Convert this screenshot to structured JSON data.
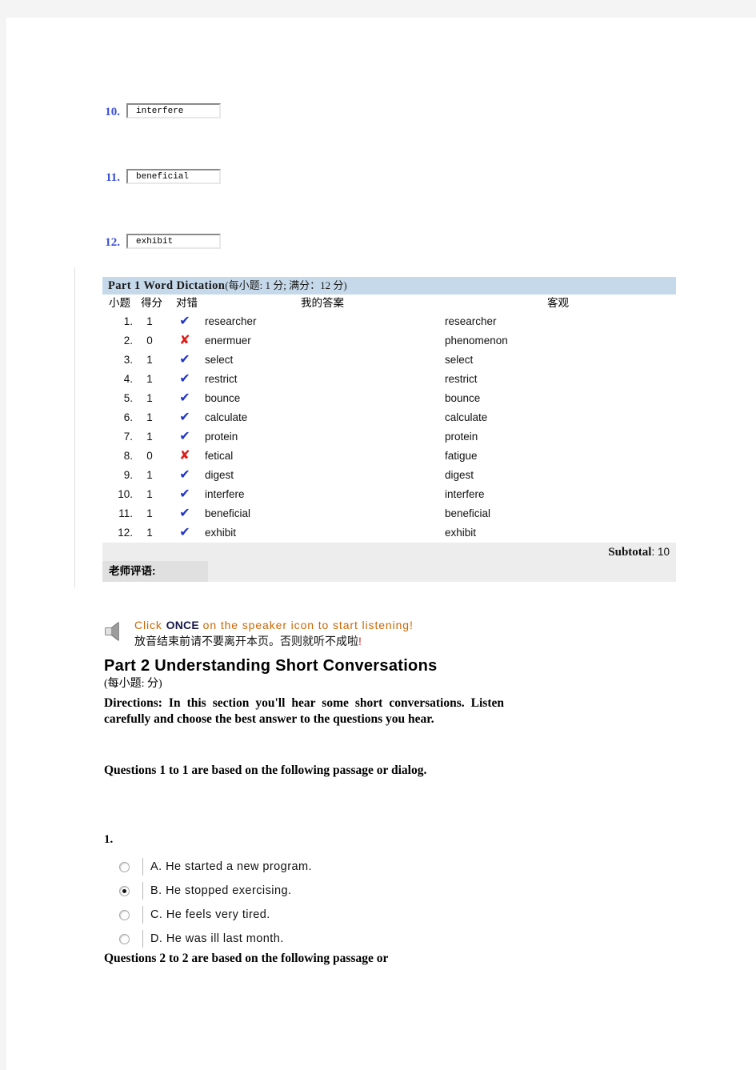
{
  "word_entries": [
    {
      "number": "10.",
      "value": "interfere"
    },
    {
      "number": "11.",
      "value": "beneficial"
    },
    {
      "number": "12.",
      "value": "exhibit"
    }
  ],
  "score_table": {
    "title": "Part 1 Word Dictation",
    "points_note": "(每小题: 1 分; 满分：12 分)",
    "columns": {
      "number": "小题",
      "score": "得分",
      "correctness": "对错",
      "my_answer": "我的答案",
      "objective": "客观"
    },
    "rows": [
      {
        "no": "1.",
        "score": "1",
        "mark": "✔",
        "correct": true,
        "mine": "researcher",
        "key": "researcher"
      },
      {
        "no": "2.",
        "score": "0",
        "mark": "✘",
        "correct": false,
        "mine": "enermuer",
        "key": "phenomenon"
      },
      {
        "no": "3.",
        "score": "1",
        "mark": "✔",
        "correct": true,
        "mine": "select",
        "key": "select"
      },
      {
        "no": "4.",
        "score": "1",
        "mark": "✔",
        "correct": true,
        "mine": "restrict",
        "key": "restrict"
      },
      {
        "no": "5.",
        "score": "1",
        "mark": "✔",
        "correct": true,
        "mine": "bounce",
        "key": "bounce"
      },
      {
        "no": "6.",
        "score": "1",
        "mark": "✔",
        "correct": true,
        "mine": "calculate",
        "key": "calculate"
      },
      {
        "no": "7.",
        "score": "1",
        "mark": "✔",
        "correct": true,
        "mine": "protein",
        "key": "protein"
      },
      {
        "no": "8.",
        "score": "0",
        "mark": "✘",
        "correct": false,
        "mine": "fetical",
        "key": "fatigue"
      },
      {
        "no": "9.",
        "score": "1",
        "mark": "✔",
        "correct": true,
        "mine": "digest",
        "key": "digest"
      },
      {
        "no": "10.",
        "score": "1",
        "mark": "✔",
        "correct": true,
        "mine": "interfere",
        "key": "interfere"
      },
      {
        "no": "11.",
        "score": "1",
        "mark": "✔",
        "correct": true,
        "mine": "beneficial",
        "key": "beneficial"
      },
      {
        "no": "12.",
        "score": "1",
        "mark": "✔",
        "correct": true,
        "mine": "exhibit",
        "key": "exhibit"
      }
    ],
    "subtotal_label": "Subtotal",
    "subtotal_value": ": 10",
    "comment_label": "老师评语:",
    "comment_value": ""
  },
  "speaker_note": {
    "icon": "speaker-icon",
    "line1_pre": "Click ",
    "line1_bold": "ONCE",
    "line1_post": " on the speaker icon to start listening!",
    "line2": "放音结束前请不要离开本页。否则就听不成啦",
    "line2_bang": "!"
  },
  "part2": {
    "title": "Part 2 Understanding Short Conversations",
    "subtitle": "(每小题:  分)",
    "directions": "Directions: In this section you'll hear some short conversations. Listen carefully and choose the best answer to the questions you hear.",
    "question_head_1": "Questions 1 to 1 are based on the following passage or dialog.",
    "question_head_2": "Questions 2 to 2 are based on the following passage or",
    "q1_number": "1.",
    "options": [
      {
        "label": "A. He started a new program.",
        "selected": false
      },
      {
        "label": "B. He stopped exercising.",
        "selected": true
      },
      {
        "label": "C. He feels very tired.",
        "selected": false
      },
      {
        "label": "D. He was ill last month.",
        "selected": false
      }
    ]
  },
  "colors": {
    "header_bar": "#c6d9ea",
    "number_blue": "#3a4fd8",
    "check_blue": "#2033cc",
    "cross_red": "#e01b18",
    "note_orange": "#cc6600",
    "page_margin": "#f4f4f4"
  }
}
